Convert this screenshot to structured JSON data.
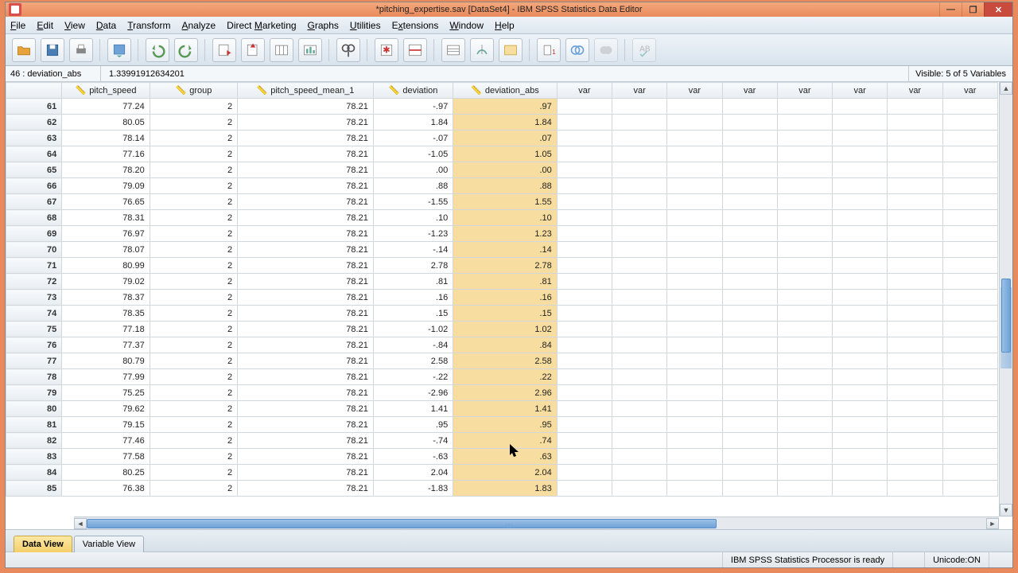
{
  "title": "*pitching_expertise.sav [DataSet4] - IBM SPSS Statistics Data Editor",
  "menu": [
    "File",
    "Edit",
    "View",
    "Data",
    "Transform",
    "Analyze",
    "Direct Marketing",
    "Graphs",
    "Utilities",
    "Extensions",
    "Window",
    "Help"
  ],
  "cellref": {
    "ref": "46 : deviation_abs",
    "val": "1.33991912634201",
    "visible": "Visible: 5 of 5 Variables"
  },
  "columns": [
    "pitch_speed",
    "group",
    "pitch_speed_mean_1",
    "deviation",
    "deviation_abs"
  ],
  "var_label": "var",
  "rows": [
    {
      "n": 61,
      "ps": "77.24",
      "gr": "2",
      "mean": "78.21",
      "dev": "-.97",
      "abs": ".97"
    },
    {
      "n": 62,
      "ps": "80.05",
      "gr": "2",
      "mean": "78.21",
      "dev": "1.84",
      "abs": "1.84"
    },
    {
      "n": 63,
      "ps": "78.14",
      "gr": "2",
      "mean": "78.21",
      "dev": "-.07",
      "abs": ".07"
    },
    {
      "n": 64,
      "ps": "77.16",
      "gr": "2",
      "mean": "78.21",
      "dev": "-1.05",
      "abs": "1.05"
    },
    {
      "n": 65,
      "ps": "78.20",
      "gr": "2",
      "mean": "78.21",
      "dev": ".00",
      "abs": ".00"
    },
    {
      "n": 66,
      "ps": "79.09",
      "gr": "2",
      "mean": "78.21",
      "dev": ".88",
      "abs": ".88"
    },
    {
      "n": 67,
      "ps": "76.65",
      "gr": "2",
      "mean": "78.21",
      "dev": "-1.55",
      "abs": "1.55"
    },
    {
      "n": 68,
      "ps": "78.31",
      "gr": "2",
      "mean": "78.21",
      "dev": ".10",
      "abs": ".10"
    },
    {
      "n": 69,
      "ps": "76.97",
      "gr": "2",
      "mean": "78.21",
      "dev": "-1.23",
      "abs": "1.23"
    },
    {
      "n": 70,
      "ps": "78.07",
      "gr": "2",
      "mean": "78.21",
      "dev": "-.14",
      "abs": ".14"
    },
    {
      "n": 71,
      "ps": "80.99",
      "gr": "2",
      "mean": "78.21",
      "dev": "2.78",
      "abs": "2.78"
    },
    {
      "n": 72,
      "ps": "79.02",
      "gr": "2",
      "mean": "78.21",
      "dev": ".81",
      "abs": ".81"
    },
    {
      "n": 73,
      "ps": "78.37",
      "gr": "2",
      "mean": "78.21",
      "dev": ".16",
      "abs": ".16"
    },
    {
      "n": 74,
      "ps": "78.35",
      "gr": "2",
      "mean": "78.21",
      "dev": ".15",
      "abs": ".15"
    },
    {
      "n": 75,
      "ps": "77.18",
      "gr": "2",
      "mean": "78.21",
      "dev": "-1.02",
      "abs": "1.02"
    },
    {
      "n": 76,
      "ps": "77.37",
      "gr": "2",
      "mean": "78.21",
      "dev": "-.84",
      "abs": ".84"
    },
    {
      "n": 77,
      "ps": "80.79",
      "gr": "2",
      "mean": "78.21",
      "dev": "2.58",
      "abs": "2.58"
    },
    {
      "n": 78,
      "ps": "77.99",
      "gr": "2",
      "mean": "78.21",
      "dev": "-.22",
      "abs": ".22"
    },
    {
      "n": 79,
      "ps": "75.25",
      "gr": "2",
      "mean": "78.21",
      "dev": "-2.96",
      "abs": "2.96"
    },
    {
      "n": 80,
      "ps": "79.62",
      "gr": "2",
      "mean": "78.21",
      "dev": "1.41",
      "abs": "1.41"
    },
    {
      "n": 81,
      "ps": "79.15",
      "gr": "2",
      "mean": "78.21",
      "dev": ".95",
      "abs": ".95"
    },
    {
      "n": 82,
      "ps": "77.46",
      "gr": "2",
      "mean": "78.21",
      "dev": "-.74",
      "abs": ".74"
    },
    {
      "n": 83,
      "ps": "77.58",
      "gr": "2",
      "mean": "78.21",
      "dev": "-.63",
      "abs": ".63"
    },
    {
      "n": 84,
      "ps": "80.25",
      "gr": "2",
      "mean": "78.21",
      "dev": "2.04",
      "abs": "2.04"
    },
    {
      "n": 85,
      "ps": "76.38",
      "gr": "2",
      "mean": "78.21",
      "dev": "-1.83",
      "abs": "1.83"
    }
  ],
  "tabs": {
    "data": "Data View",
    "var": "Variable View"
  },
  "status": {
    "proc": "IBM SPSS Statistics Processor is ready",
    "unicode": "Unicode:ON"
  },
  "toolbar_icons": [
    "open",
    "save",
    "print",
    "data",
    "undo",
    "redo",
    "goto-case",
    "goto-var",
    "variables",
    "run",
    "find",
    "insert-case",
    "split",
    "weight",
    "select",
    "value-labels",
    "use-sets",
    "show-all",
    "spellcheck"
  ]
}
